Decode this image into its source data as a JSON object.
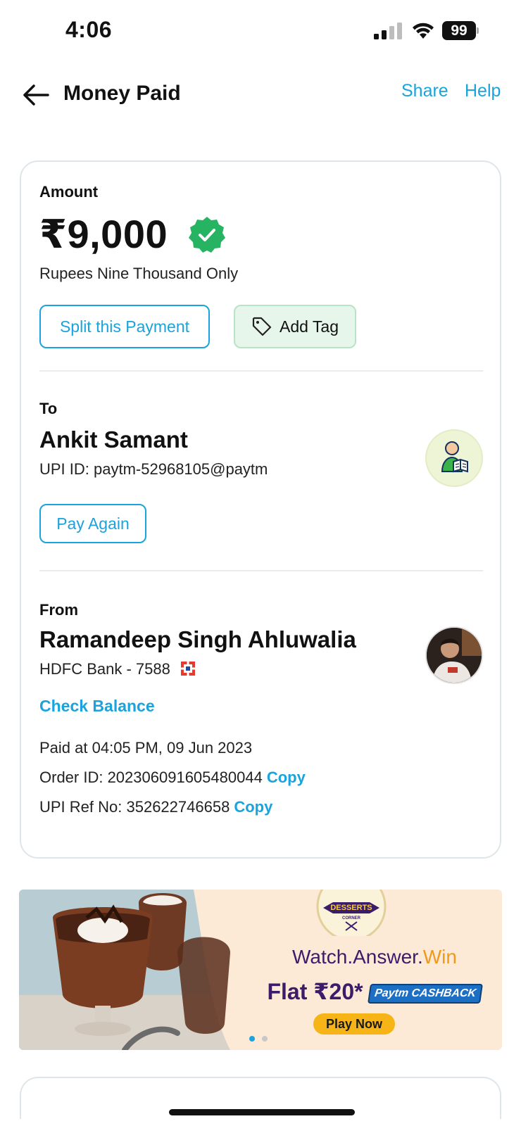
{
  "status_bar": {
    "time": "4:06",
    "battery": "99",
    "icons": [
      "signal-icon",
      "wifi-icon",
      "battery-icon"
    ]
  },
  "header": {
    "title": "Money Paid",
    "share_label": "Share",
    "help_label": "Help",
    "back_icon": "back-arrow-icon"
  },
  "payment": {
    "amount_label": "Amount",
    "amount": "₹9,000",
    "amount_words": "Rupees Nine Thousand Only",
    "split_label": "Split this Payment",
    "tag_label": "Add Tag"
  },
  "payee": {
    "label": "To",
    "name": "Ankit Samant",
    "upi_id": "UPI ID: paytm-52968105@paytm",
    "pay_again_label": "Pay Again"
  },
  "payer": {
    "label": "From",
    "name": "Ramandeep Singh Ahluwalia",
    "bank": "HDFC Bank - 7588",
    "check_balance_label": "Check Balance"
  },
  "details": {
    "paid_at": "Paid at 04:05 PM, 09 Jun 2023",
    "order_id": "Order ID: 202306091605480044",
    "upi_ref": "UPI Ref No: 352622746658",
    "copy_label": "Copy"
  },
  "banner": {
    "logo_text_1": "DESSERTS",
    "logo_text_2": "CORNER",
    "title_part1": "Watch.Answer.",
    "title_part2": "Win",
    "offer": "Flat ₹20*",
    "cashback_brand": "Paytm",
    "cashback_label": "CASHBACK",
    "play_label": "Play Now",
    "active_slide": 1,
    "total_slides": 2
  },
  "colors": {
    "accent": "#1aa3dc",
    "verified": "#27b462",
    "tag_bg": "#e6f6ea",
    "banner_bg": "#fce9d6",
    "banner_text": "#3b1c6b",
    "banner_highlight": "#f09a1d"
  }
}
